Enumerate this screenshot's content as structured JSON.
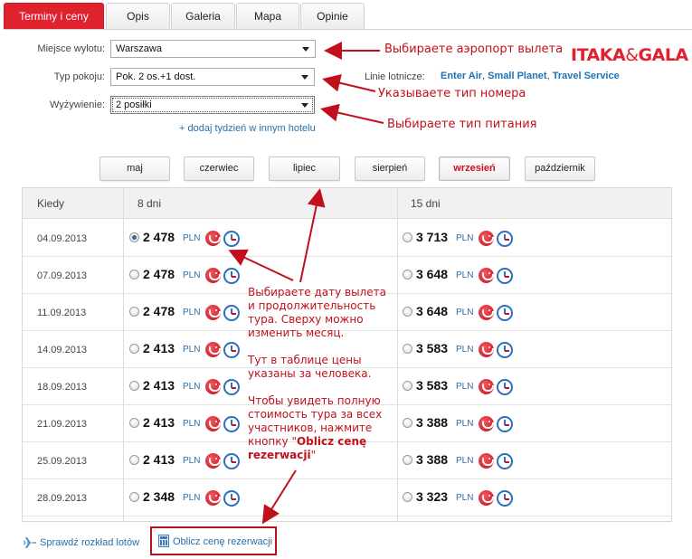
{
  "tabs": [
    "Terminy i ceny",
    "Opis",
    "Galeria",
    "Mapa",
    "Opinie"
  ],
  "form": {
    "departure_label": "Miejsce wylotu:",
    "departure_value": "Warszawa",
    "room_label": "Typ pokoju:",
    "room_value": "Pok. 2 os.+1 dost.",
    "meal_label": "Wyżywienie:",
    "meal_value": "2 posiłki",
    "add_week_link": "+ dodaj tydzień w innym hotelu",
    "airlines_label": "Linie lotnicze:",
    "airlines": [
      "Enter Air",
      "Small Planet",
      "Travel Service"
    ],
    "airline_sep": ","
  },
  "brand": {
    "left": "ITAKA",
    "amp": "&",
    "right": "GALA"
  },
  "annotations": {
    "airport": "Выбираете аэропорт вылета",
    "room": "Указываете тип номера",
    "meal": "Выбираете тип питания",
    "table_note": [
      "Выбираете дату вылета",
      "и продолжительность",
      "тура. Сверху можно",
      "изменить месяц.",
      "",
      "Тут в таблице цены",
      "указаны за человека.",
      "",
      "Чтобы увидеть полную",
      "стоимость тура за всех",
      "участников, нажмите",
      "кнопку \""
    ],
    "button_name_1": "Oblicz cenę",
    "button_name_2": "rezerwacji",
    "quote_close": "\""
  },
  "months": [
    {
      "label": "maj",
      "active": false
    },
    {
      "label": "czerwiec",
      "active": false
    },
    {
      "label": "lipiec",
      "active": false
    },
    {
      "label": "sierpień",
      "active": false
    },
    {
      "label": "wrzesień",
      "active": true
    },
    {
      "label": "październik",
      "active": false
    }
  ],
  "table": {
    "headers": [
      "Kiedy",
      "8 dni",
      "15 dni"
    ],
    "currency": "PLN",
    "rows": [
      {
        "date": "04.09.2013",
        "p8": "2 478",
        "p15": "3 713",
        "selected8": true
      },
      {
        "date": "07.09.2013",
        "p8": "2 478",
        "p15": "3 648",
        "selected8": false
      },
      {
        "date": "11.09.2013",
        "p8": "2 478",
        "p15": "3 648",
        "selected8": false
      },
      {
        "date": "14.09.2013",
        "p8": "2 413",
        "p15": "3 583",
        "selected8": false
      },
      {
        "date": "18.09.2013",
        "p8": "2 413",
        "p15": "3 583",
        "selected8": false
      },
      {
        "date": "21.09.2013",
        "p8": "2 413",
        "p15": "3 388",
        "selected8": false
      },
      {
        "date": "25.09.2013",
        "p8": "2 413",
        "p15": "3 388",
        "selected8": false
      },
      {
        "date": "28.09.2013",
        "p8": "2 348",
        "p15": "3 323",
        "selected8": false
      }
    ]
  },
  "footer": {
    "flights_link": "Sprawdź rozkład lotów",
    "calc_button": "Oblicz cenę rezerwacji"
  },
  "colors": {
    "accent": "#e0212e",
    "annotation": "#c0101c",
    "link": "#2a6ea8",
    "airline": "#1a72b8"
  }
}
